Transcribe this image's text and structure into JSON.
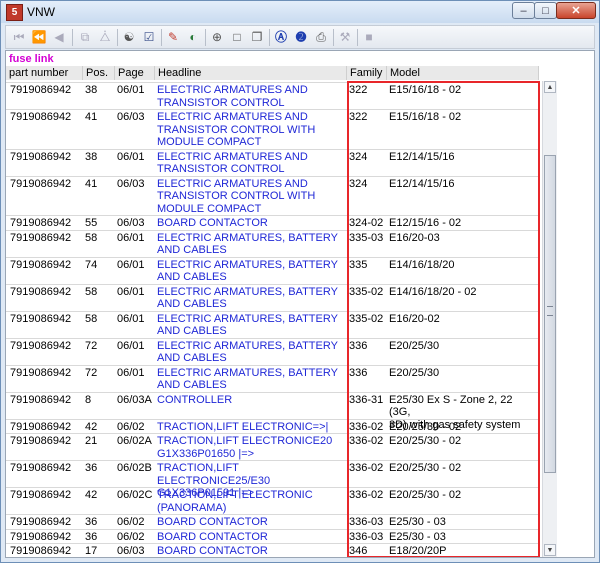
{
  "window": {
    "title": "VNW",
    "app_icon_glyph": "5"
  },
  "toolbar": {
    "icons": [
      "first-icon",
      "prev-fast-icon",
      "prev-icon",
      "copy-page-icon",
      "paste-page-icon",
      "cart-icon",
      "checklist-icon",
      "pencil-tool-icon",
      "color-wheel-icon",
      "zoom-icon",
      "page-icon",
      "pages-icon",
      "circle-a-icon",
      "circle-2-icon",
      "print-icon",
      "tools-icon",
      "stop-icon"
    ]
  },
  "list": {
    "heading": "fuse link",
    "columns": {
      "part_number": "part number",
      "pos": "Pos.",
      "page": "Page",
      "headline": "Headline",
      "family": "Family",
      "model": "Model"
    },
    "rows": [
      {
        "part": "7919086942",
        "pos": "38",
        "page": "06/01",
        "headline": "ELECTRIC ARMATURES AND\nTRANSISTOR CONTROL",
        "family": "322",
        "model": "E15/16/18 - 02"
      },
      {
        "part": "7919086942",
        "pos": "41",
        "page": "06/03",
        "headline": "ELECTRIC ARMATURES AND\nTRANSISTOR CONTROL WITH\nMODULE COMPACT",
        "family": "322",
        "model": "E15/16/18 - 02"
      },
      {
        "part": "7919086942",
        "pos": "38",
        "page": "06/01",
        "headline": "ELECTRIC ARMATURES AND\nTRANSISTOR CONTROL",
        "family": "324",
        "model": "E12/14/15/16"
      },
      {
        "part": "7919086942",
        "pos": "41",
        "page": "06/03",
        "headline": "ELECTRIC ARMATURES AND\nTRANSISTOR CONTROL WITH\nMODULE COMPACT",
        "family": "324",
        "model": "E12/14/15/16"
      },
      {
        "part": "7919086942",
        "pos": "55",
        "page": "06/03",
        "headline": "BOARD CONTACTOR",
        "family": "324-02",
        "model": "E12/15/16 - 02"
      },
      {
        "part": "7919086942",
        "pos": "58",
        "page": "06/01",
        "headline": "ELECTRIC ARMATURES, BATTERY\nAND CABLES",
        "family": "335-03",
        "model": "E16/20-03"
      },
      {
        "part": "7919086942",
        "pos": "74",
        "page": "06/01",
        "headline": "ELECTRIC ARMATURES, BATTERY\nAND CABLES",
        "family": "335",
        "model": "E14/16/18/20"
      },
      {
        "part": "7919086942",
        "pos": "58",
        "page": "06/01",
        "headline": "ELECTRIC ARMATURES, BATTERY\nAND CABLES",
        "family": "335-02",
        "model": "E14/16/18/20 - 02"
      },
      {
        "part": "7919086942",
        "pos": "58",
        "page": "06/01",
        "headline": "ELECTRIC ARMATURES, BATTERY\nAND CABLES",
        "family": "335-02",
        "model": "E16/20-02"
      },
      {
        "part": "7919086942",
        "pos": "72",
        "page": "06/01",
        "headline": "ELECTRIC ARMATURES, BATTERY\nAND CABLES",
        "family": "336",
        "model": "E20/25/30"
      },
      {
        "part": "7919086942",
        "pos": "72",
        "page": "06/01",
        "headline": "ELECTRIC ARMATURES, BATTERY\nAND CABLES",
        "family": "336",
        "model": "E20/25/30"
      },
      {
        "part": "7919086942",
        "pos": "8",
        "page": "06/03A",
        "headline": "CONTROLLER",
        "family": "336-31",
        "model": "E25/30 Ex S - Zone 2, 22 (3G,\n3D) with gas safety system"
      },
      {
        "part": "7919086942",
        "pos": "42",
        "page": "06/02",
        "headline": "TRACTION,LIFT ELECTRONIC=>|",
        "family": "336-02",
        "model": "E20/25/30 - 02"
      },
      {
        "part": "7919086942",
        "pos": "21",
        "page": "06/02A",
        "headline": "TRACTION,LIFT ELECTRONICE20\nG1X336P01650 |=>",
        "family": "336-02",
        "model": "E20/25/30 - 02"
      },
      {
        "part": "7919086942",
        "pos": "36",
        "page": "06/02B",
        "headline": "TRACTION,LIFT ELECTRONICE25/E30\nG1X336P01591 |=>",
        "family": "336-02",
        "model": "E20/25/30 - 02"
      },
      {
        "part": "7919086942",
        "pos": "42",
        "page": "06/02C",
        "headline": "TRACTION,LIFT ELECTRONIC\n(PANORAMA)",
        "family": "336-02",
        "model": "E20/25/30 - 02"
      },
      {
        "part": "7919086942",
        "pos": "36",
        "page": "06/02",
        "headline": "BOARD CONTACTOR",
        "family": "336-03",
        "model": "E25/30 - 03"
      },
      {
        "part": "7919086942",
        "pos": "36",
        "page": "06/02",
        "headline": "BOARD CONTACTOR",
        "family": "336-03",
        "model": "E25/30 - 03"
      },
      {
        "part": "7919086942",
        "pos": "17",
        "page": "06/03",
        "headline": "BOARD CONTACTOR",
        "family": "346",
        "model": "E18/20/20P"
      }
    ]
  },
  "colors": {
    "headline_link": "#1f27d6",
    "heading": "#d400d4",
    "highlight_box": "#e8262a"
  }
}
